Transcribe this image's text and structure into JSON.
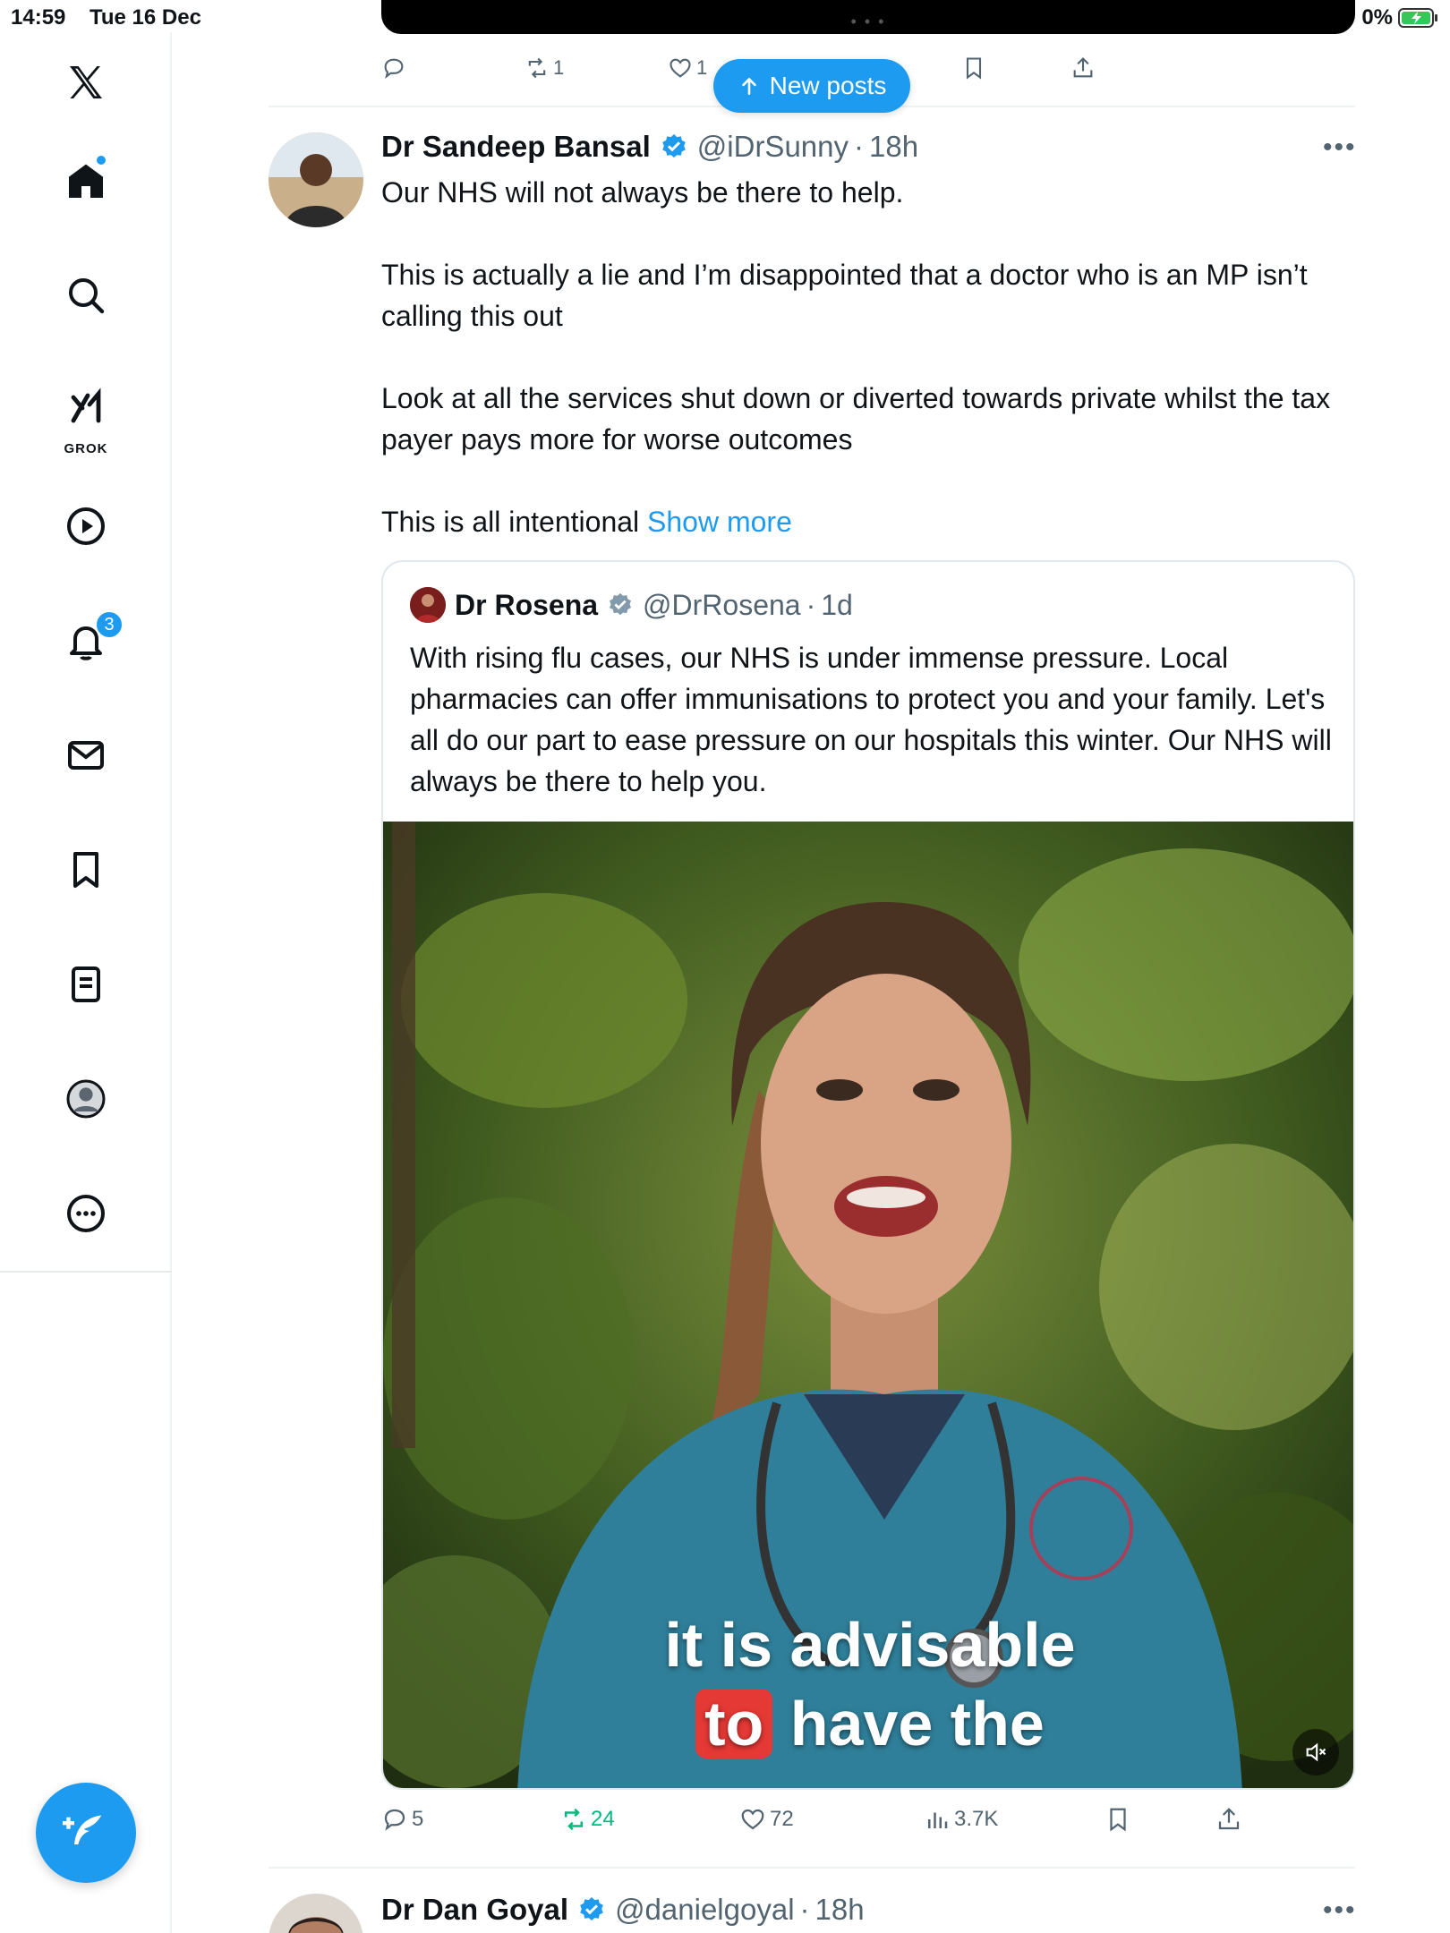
{
  "status_bar": {
    "time": "14:59",
    "date": "Tue 16 Dec",
    "battery": "0%"
  },
  "sidebar": {
    "items": [
      {
        "name": "x-logo-icon"
      },
      {
        "name": "home-icon"
      },
      {
        "name": "search-icon"
      },
      {
        "name": "grok-icon",
        "label": "GROK"
      },
      {
        "name": "video-icon"
      },
      {
        "name": "notifications-icon",
        "badge": "3"
      },
      {
        "name": "messages-icon"
      },
      {
        "name": "bookmarks-icon"
      },
      {
        "name": "lists-icon"
      },
      {
        "name": "profile-icon"
      },
      {
        "name": "more-icon"
      }
    ]
  },
  "top_actions": {
    "replies": "",
    "reposts": "1",
    "likes": "1"
  },
  "new_posts_label": "New posts",
  "post": {
    "author_name": "Dr Sandeep Bansal",
    "handle": "@iDrSunny",
    "separator": "·",
    "time": "18h",
    "paragraphs": [
      "Our NHS will not always be there to help.",
      "This is actually a lie and I’m disappointed that a doctor who is an MP isn’t calling this out",
      "Look at all the services shut down or diverted towards private whilst the tax payer pays more for worse outcomes",
      "This is all intentional"
    ],
    "show_more": "Show more",
    "quote": {
      "author_name": "Dr Rosena",
      "handle": "@DrRosena",
      "separator": "·",
      "time": "1d",
      "text": "With rising flu cases, our NHS is under immense pressure. Local pharmacies can offer immunisations to protect you and your family. Let's all do our part to ease pressure on our hospitals this winter. Our NHS will always be there to help you.",
      "video_caption_line1": "it is advisable",
      "video_caption_line2_highlight": "to",
      "video_caption_line2_rest": "have the"
    },
    "stats": {
      "replies": "5",
      "reposts": "24",
      "likes": "72",
      "views": "3.7K"
    }
  },
  "next_post": {
    "author_name": "Dr Dan Goyal",
    "handle": "@danielgoyal",
    "separator": "·",
    "time": "18h"
  },
  "colors": {
    "accent": "#1d9bf0",
    "repost_active": "#00ba7c",
    "muted": "#536471"
  }
}
